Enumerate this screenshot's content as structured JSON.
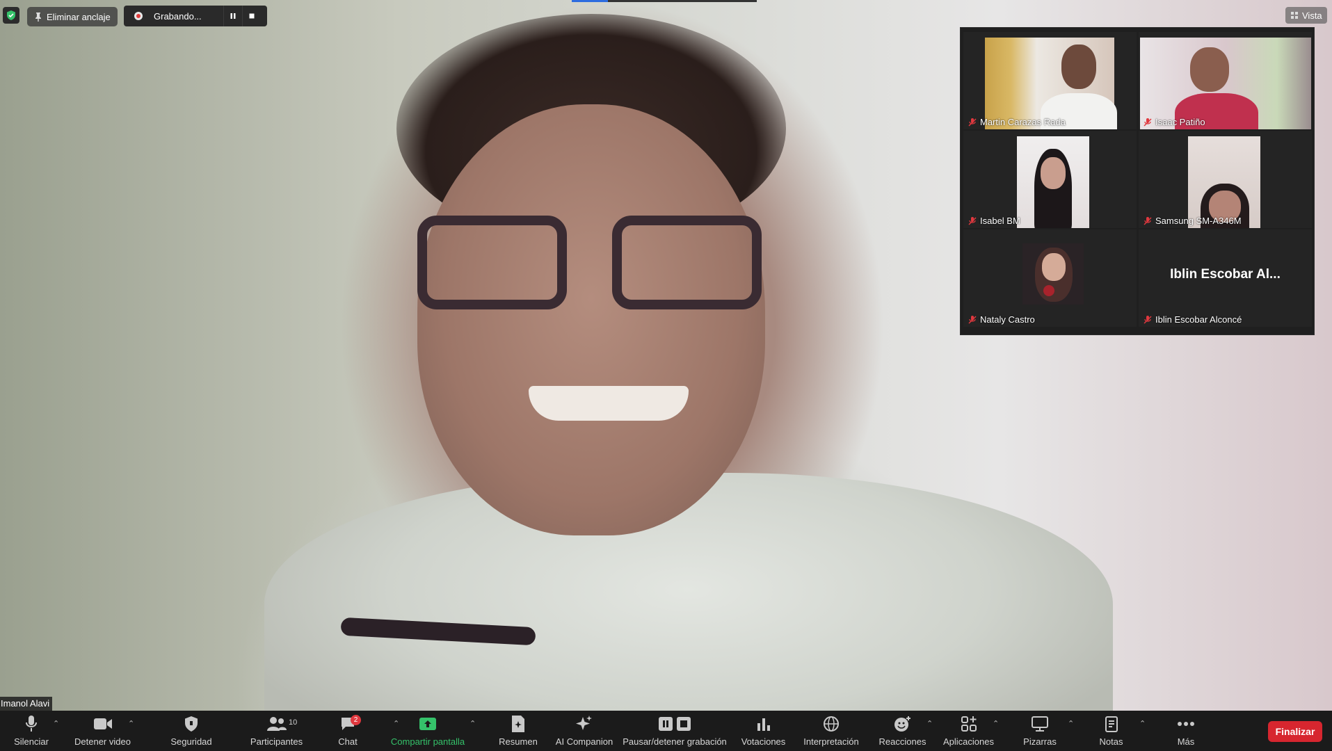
{
  "top": {
    "pin_label": "Eliminar anclaje",
    "recording_label": "Grabando...",
    "view_label": "Vista"
  },
  "main": {
    "speaker_name": "Imanol Alavi"
  },
  "gallery": {
    "tiles": [
      {
        "name": "Martin Carazas Rada"
      },
      {
        "name": "Isaac Patiño"
      },
      {
        "name": "Isabel BM"
      },
      {
        "name": "Samsung SM-A346M"
      },
      {
        "name": "Nataly Castro"
      },
      {
        "name": "Iblin Escobar Alconcé",
        "display_text": "Iblin Escobar Al..."
      }
    ]
  },
  "toolbar": {
    "mute": "Silenciar",
    "video": "Detener video",
    "security": "Seguridad",
    "participants": "Participantes",
    "participants_count": "10",
    "chat": "Chat",
    "chat_badge": "2",
    "share": "Compartir pantalla",
    "summary": "Resumen",
    "ai": "AI Companion",
    "pause_rec": "Pausar/detener grabación",
    "polls": "Votaciones",
    "interpretation": "Interpretación",
    "reactions": "Reacciones",
    "apps": "Aplicaciones",
    "whiteboards": "Pizarras",
    "notes": "Notas",
    "more": "Más",
    "end": "Finalizar"
  },
  "colors": {
    "accent_green": "#35c26a",
    "end_red": "#d7262f",
    "badge_red": "#e0383e",
    "muted_red": "#e0383e"
  }
}
